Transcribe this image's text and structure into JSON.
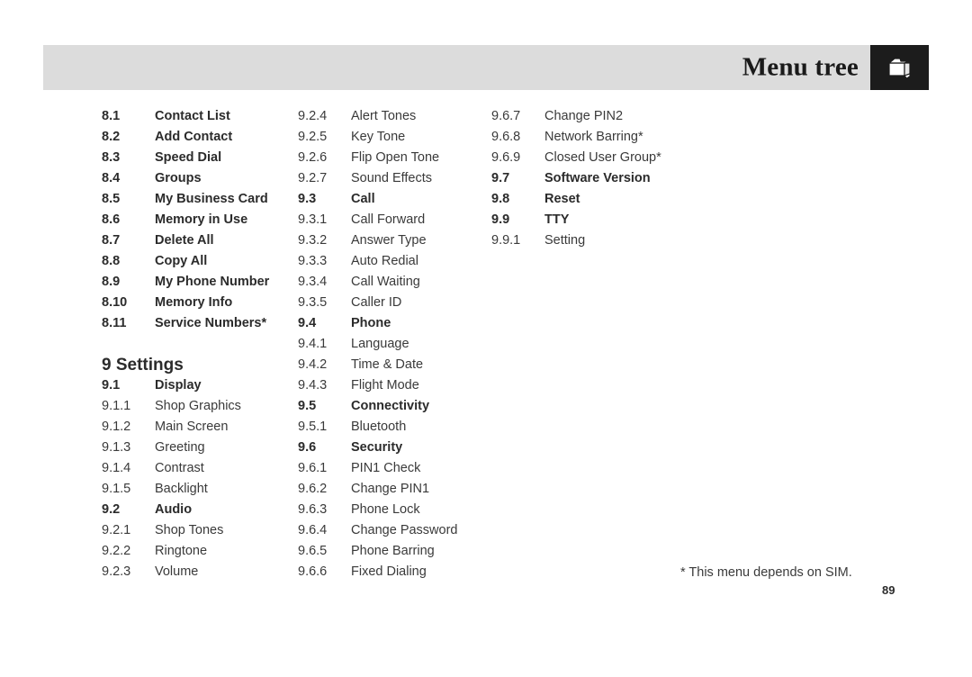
{
  "header": {
    "title": "Menu tree",
    "icon": "folder-icon",
    "bar_color": "#dcdcdc",
    "icon_box_color": "#1c1c1c"
  },
  "columns": [
    {
      "id": "column-1",
      "blocks": [
        {
          "type": "rows",
          "rows": [
            {
              "num": "8.1",
              "label": "Contact List",
              "bold": true
            },
            {
              "num": "8.2",
              "label": "Add Contact",
              "bold": true
            },
            {
              "num": "8.3",
              "label": "Speed Dial",
              "bold": true
            },
            {
              "num": "8.4",
              "label": "Groups",
              "bold": true
            },
            {
              "num": "8.5",
              "label": "My Business Card",
              "bold": true
            },
            {
              "num": "8.6",
              "label": "Memory in Use",
              "bold": true
            },
            {
              "num": "8.7",
              "label": "Delete All",
              "bold": true
            },
            {
              "num": "8.8",
              "label": "Copy All",
              "bold": true
            },
            {
              "num": "8.9",
              "label": "My Phone Number",
              "bold": true
            },
            {
              "num": "8.10",
              "label": "Memory Info",
              "bold": true
            },
            {
              "num": "8.11",
              "label": "Service Numbers*",
              "bold": true
            }
          ]
        },
        {
          "type": "spacer"
        },
        {
          "type": "heading",
          "text": "9 Settings"
        },
        {
          "type": "rows",
          "rows": [
            {
              "num": "9.1",
              "label": "Display",
              "bold": true
            },
            {
              "num": "9.1.1",
              "label": "Shop Graphics",
              "bold": false
            },
            {
              "num": "9.1.2",
              "label": "Main Screen",
              "bold": false
            },
            {
              "num": "9.1.3",
              "label": "Greeting",
              "bold": false
            },
            {
              "num": "9.1.4",
              "label": "Contrast",
              "bold": false
            },
            {
              "num": "9.1.5",
              "label": "Backlight",
              "bold": false
            },
            {
              "num": "9.2",
              "label": "Audio",
              "bold": true
            },
            {
              "num": "9.2.1",
              "label": "Shop Tones",
              "bold": false
            },
            {
              "num": "9.2.2",
              "label": "Ringtone",
              "bold": false
            },
            {
              "num": "9.2.3",
              "label": "Volume",
              "bold": false
            }
          ]
        }
      ]
    },
    {
      "id": "column-2",
      "blocks": [
        {
          "type": "rows",
          "rows": [
            {
              "num": "9.2.4",
              "label": "Alert Tones",
              "bold": false
            },
            {
              "num": "9.2.5",
              "label": "Key Tone",
              "bold": false
            },
            {
              "num": "9.2.6",
              "label": "Flip Open Tone",
              "bold": false
            },
            {
              "num": "9.2.7",
              "label": "Sound Effects",
              "bold": false
            },
            {
              "num": "9.3",
              "label": "Call",
              "bold": true
            },
            {
              "num": "9.3.1",
              "label": "Call Forward",
              "bold": false
            },
            {
              "num": "9.3.2",
              "label": "Answer Type",
              "bold": false
            },
            {
              "num": "9.3.3",
              "label": "Auto Redial",
              "bold": false
            },
            {
              "num": "9.3.4",
              "label": "Call Waiting",
              "bold": false
            },
            {
              "num": "9.3.5",
              "label": "Caller ID",
              "bold": false
            },
            {
              "num": "9.4",
              "label": "Phone",
              "bold": true
            },
            {
              "num": "9.4.1",
              "label": "Language",
              "bold": false
            },
            {
              "num": "9.4.2",
              "label": "Time & Date",
              "bold": false
            },
            {
              "num": "9.4.3",
              "label": "Flight Mode",
              "bold": false
            },
            {
              "num": "9.5",
              "label": "Connectivity",
              "bold": true
            },
            {
              "num": "9.5.1",
              "label": "Bluetooth",
              "bold": false
            },
            {
              "num": "9.6",
              "label": "Security",
              "bold": true
            },
            {
              "num": "9.6.1",
              "label": "PIN1 Check",
              "bold": false
            },
            {
              "num": "9.6.2",
              "label": "Change PIN1",
              "bold": false
            },
            {
              "num": "9.6.3",
              "label": "Phone Lock",
              "bold": false
            },
            {
              "num": "9.6.4",
              "label": "Change Password",
              "bold": false
            },
            {
              "num": "9.6.5",
              "label": "Phone Barring",
              "bold": false
            },
            {
              "num": "9.6.6",
              "label": "Fixed Dialing",
              "bold": false
            }
          ]
        }
      ]
    },
    {
      "id": "column-3",
      "blocks": [
        {
          "type": "rows",
          "rows": [
            {
              "num": "9.6.7",
              "label": "Change PIN2",
              "bold": false
            },
            {
              "num": "9.6.8",
              "label": "Network Barring*",
              "bold": false
            },
            {
              "num": "9.6.9",
              "label": "Closed User Group*",
              "bold": false
            },
            {
              "num": "9.7",
              "label": "Software Version",
              "bold": true
            },
            {
              "num": "9.8",
              "label": "Reset",
              "bold": true
            },
            {
              "num": "9.9",
              "label": "TTY",
              "bold": true
            },
            {
              "num": "9.9.1",
              "label": "Setting",
              "bold": false
            }
          ]
        }
      ]
    }
  ],
  "footnote": "* This menu depends on SIM.",
  "page_number": "89"
}
